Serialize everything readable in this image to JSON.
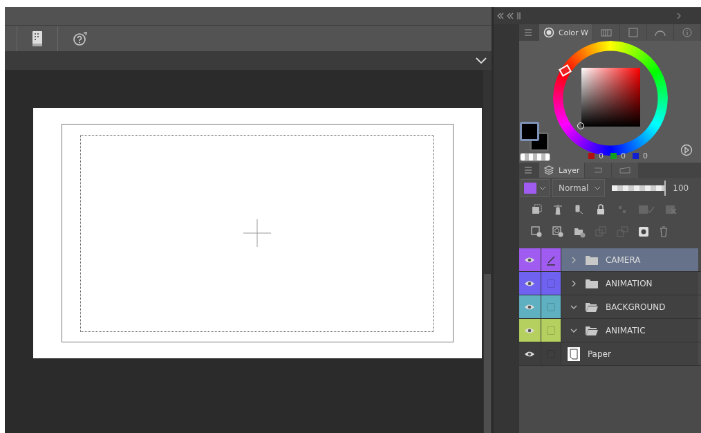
{
  "color_panel": {
    "tab_label": "Color W",
    "values": [
      {
        "value": "0",
        "color": "#b01010"
      },
      {
        "value": "0",
        "color": "#10a020"
      },
      {
        "value": "0",
        "color": "#1020d0"
      }
    ]
  },
  "layer_panel": {
    "tab_label": "Layer",
    "blend_mode": "Normal",
    "opacity": {
      "reading": "100",
      "level": 1
    },
    "layers": [
      {
        "name": "CAMERA",
        "kind": "folder",
        "expanded": false,
        "selected": true,
        "editing": true,
        "color": "#a05cf0"
      },
      {
        "name": "ANIMATION",
        "kind": "folder",
        "expanded": false,
        "selected": false,
        "editing": false,
        "color": "#6f62f0"
      },
      {
        "name": "BACKGROUND",
        "kind": "folder",
        "expanded": true,
        "selected": false,
        "editing": false,
        "color": "#5fb0c0"
      },
      {
        "name": "ANIMATIC",
        "kind": "folder",
        "expanded": true,
        "selected": false,
        "editing": false,
        "color": "#b6d060"
      },
      {
        "name": "Paper",
        "kind": "paper",
        "selected": false,
        "editing": false
      }
    ]
  }
}
